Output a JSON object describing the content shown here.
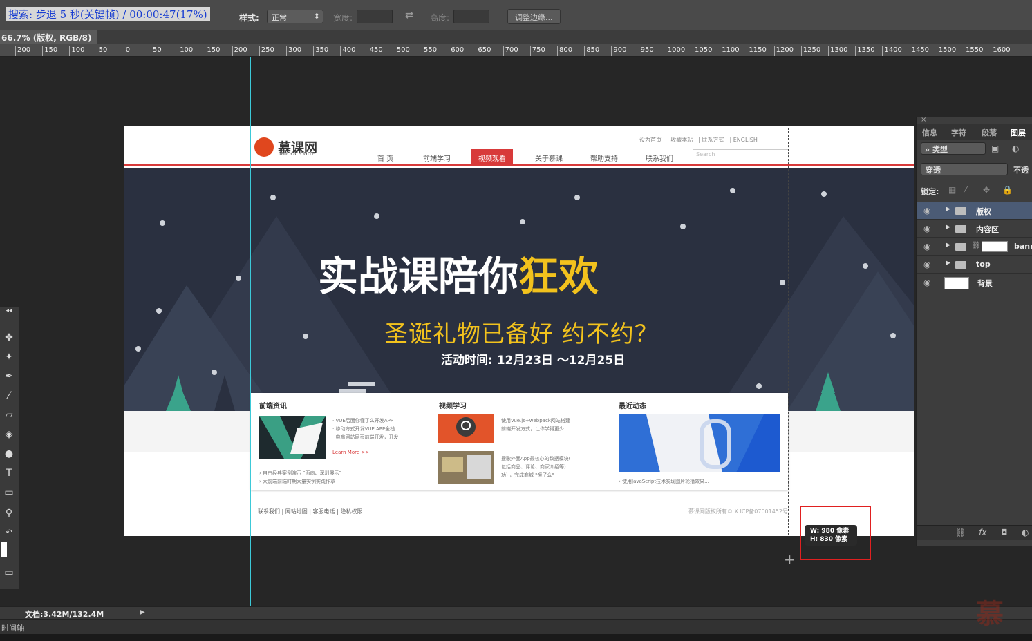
{
  "caption": "搜索: 步退 5 秒(关键帧) / 00:00:47(17%)",
  "options_bar": {
    "style_label": "样式:",
    "style_value": "正常",
    "width_label": "宽度:",
    "height_label": "高度:",
    "refine_button": "调整边缘..."
  },
  "document": {
    "tab_title": "66.7% (版权, RGB/8)"
  },
  "ruler_ticks": [
    "200",
    "150",
    "100",
    "50",
    "0",
    "50",
    "100",
    "150",
    "200",
    "250",
    "300",
    "350",
    "400",
    "450",
    "500",
    "550",
    "600",
    "650",
    "700",
    "750",
    "800",
    "850",
    "900",
    "950",
    "1000",
    "1050",
    "1100",
    "1150",
    "1200",
    "1250",
    "1300",
    "1350",
    "1400",
    "1450",
    "1500",
    "1550",
    "1600"
  ],
  "site": {
    "logo_text": "慕课网",
    "logo_sub": "imooc.com",
    "top_links": [
      "设为首页",
      "收藏本站",
      "联系方式",
      "ENGLISH"
    ],
    "nav": [
      "首 页",
      "前端学习",
      "视频观看",
      "关于慕课",
      "帮助支持",
      "联系我们"
    ],
    "nav_active_index": 2,
    "search_placeholder": "Search",
    "banner_title_main": "实战课陪你",
    "banner_title_highlight": "狂欢",
    "banner_subtitle": "圣诞礼物已备好 约不约？",
    "banner_date": "活动时间: 12月23日 ～12月25日",
    "columns": [
      {
        "title": "前端资讯",
        "lines": [
          "· VUE后面你懂了么开发APP",
          "· 移动方式开发VUE APP全栈",
          "· 电商网站网页前端开发，开发"
        ],
        "more": "Learn More >>",
        "bottom": [
          "› 自由经典案例演示 \"面向、深圳展示\"",
          "› 大前端前端时期大量实例实践作章"
        ]
      },
      {
        "title": "视频学习",
        "lines": [
          "使用Vue.js+webpack网站搭建",
          "前端开发方式，让你学得更少"
        ],
        "lines2": [
          "搜歌外面App最核心的数据模块(",
          "包括商品、评论、商家介绍等)",
          "功) ，完成商城 \"饿了么\""
        ]
      },
      {
        "title": "最近动态",
        "bottom": [
          "› 使用JavaScript技术实现图片轮播效果..."
        ]
      }
    ],
    "footer_links": "联系我们 | 网站地图 | 客服电话 | 隐私权限",
    "footer_copy": "慕课网版权所有© X ICP备07001452号"
  },
  "size_hint": {
    "w": "W: 980 像素",
    "h": "H: 830 像素"
  },
  "layers_panel": {
    "tabs": [
      "信息",
      "字符",
      "段落",
      "图层"
    ],
    "active_tab": 3,
    "filter_label": "类型",
    "blend_mode": "穿透",
    "opacity_label": "不透",
    "lock_label": "锁定:",
    "layers": [
      {
        "name": "版权",
        "type": "folder",
        "selected": true
      },
      {
        "name": "内容区",
        "type": "folder",
        "selected": false
      },
      {
        "name": "banner",
        "type": "folder-mask",
        "selected": false
      },
      {
        "name": "top",
        "type": "folder",
        "selected": false
      },
      {
        "name": "背景",
        "type": "pixel",
        "selected": false
      }
    ]
  },
  "status": {
    "doc_size": "文档:3.42M/132.4M",
    "timeline_label": "时间轴"
  },
  "watermark": "慕",
  "colors": {
    "ps_bg": "#282828",
    "guide": "#3cc9d8",
    "brand_red": "#d83a3a",
    "banner_bg": "#2a3040",
    "banner_yellow": "#f2c21d",
    "highlight_frame": "#e02020"
  }
}
